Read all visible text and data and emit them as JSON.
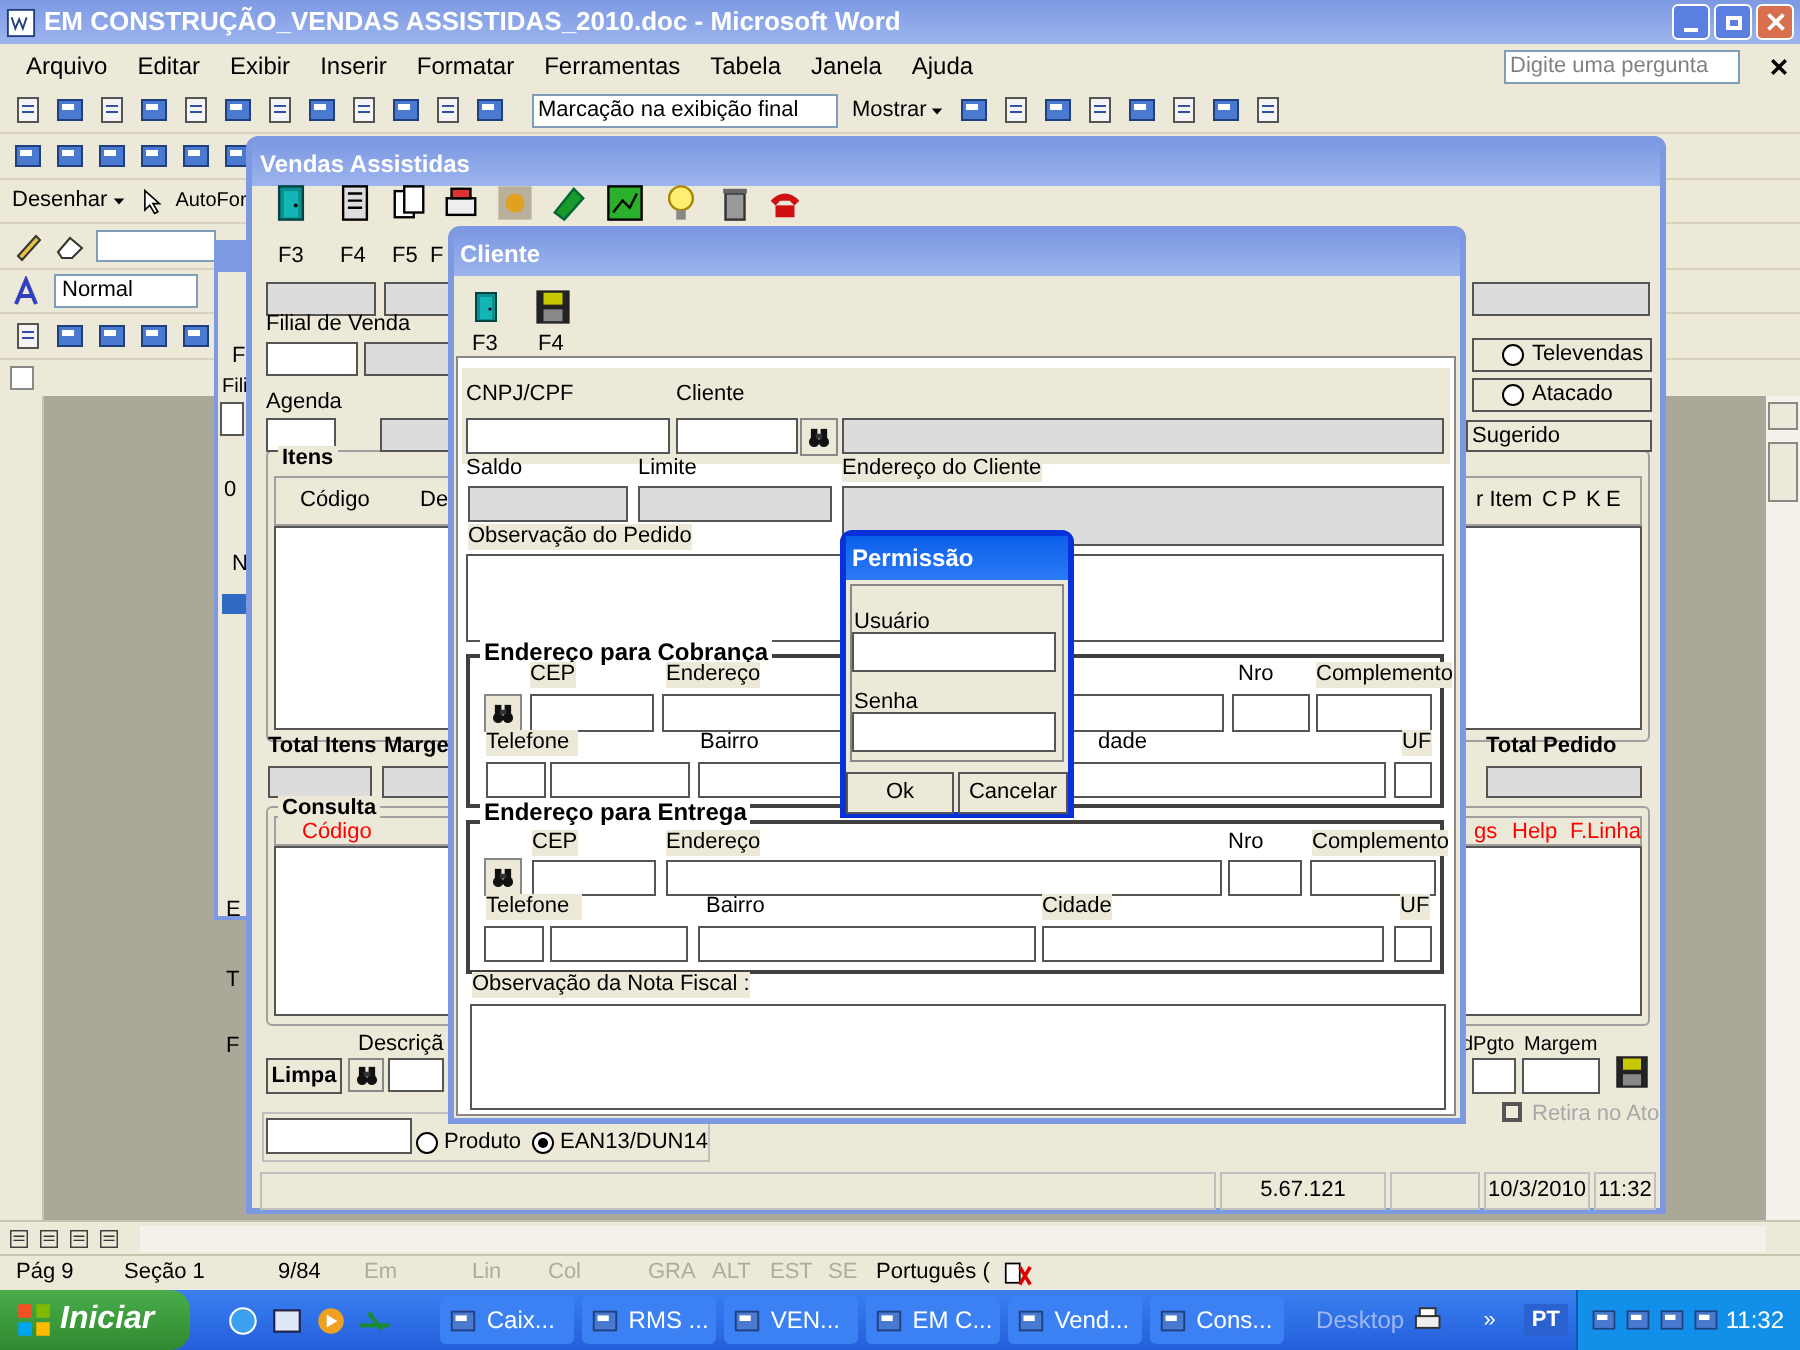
{
  "word": {
    "title": "EM CONSTRUÇÃO_VENDAS ASSISTIDAS_2010.doc - Microsoft Word",
    "menu": [
      "Arquivo",
      "Editar",
      "Exibir",
      "Inserir",
      "Formatar",
      "Ferramentas",
      "Tabela",
      "Janela",
      "Ajuda"
    ],
    "question_placeholder": "Digite uma pergunta",
    "markup_view": "Marcação na exibição final",
    "show_button": "Mostrar",
    "draw_menu": "Desenhar",
    "autoshapes_menu": "AutoFor",
    "style": "Normal",
    "status_bar": [
      {
        "text": "Pág 9",
        "disabled": false
      },
      {
        "text": "Seção 1",
        "disabled": false
      },
      {
        "text": "9/84",
        "disabled": false
      },
      {
        "text": "Em",
        "disabled": true
      },
      {
        "text": "Lin",
        "disabled": true
      },
      {
        "text": "Col",
        "disabled": true
      },
      {
        "text": "GRA",
        "disabled": true
      },
      {
        "text": "ALT",
        "disabled": true
      },
      {
        "text": "EST",
        "disabled": true
      },
      {
        "text": "SE",
        "disabled": true
      },
      {
        "text": "Português (",
        "disabled": false
      }
    ]
  },
  "background_window": {
    "labels": [
      "F",
      "Fili",
      "0",
      "N",
      "E",
      "T",
      "F"
    ]
  },
  "vendas": {
    "title": "Vendas Assistidas",
    "toolbar_keys": [
      "F3",
      "F4",
      "F5",
      "F"
    ],
    "labels": [
      "Filial de Venda",
      "Agenda",
      "Itens",
      "Código",
      "De",
      "r Item",
      "C",
      "P",
      "K",
      "E",
      "Total Itens",
      "Marge",
      "Total Pedido",
      "Consulta",
      "Código",
      "gs",
      "Help",
      "F.Linha",
      "Descriçã",
      "dPgto",
      "Margem"
    ],
    "modes": [
      {
        "label": "Televendas",
        "selected": false
      },
      {
        "label": "Atacado",
        "selected": false
      }
    ],
    "suggested": "Sugerido",
    "clear_button": "Limpa",
    "pickup": {
      "label": "Retira no Ato",
      "checked": false,
      "disabled": true
    },
    "search_by": [
      {
        "label": "Produto",
        "selected": false
      },
      {
        "label": "EAN13/DUN14",
        "selected": true
      }
    ],
    "status_bar": [
      "5.67.121",
      "10/3/2010",
      "11:32"
    ]
  },
  "cliente": {
    "title": "Cliente",
    "toolbar_keys": [
      "F3",
      "F4"
    ],
    "labels": [
      "CNPJ/CPF",
      "Cliente",
      "Saldo",
      "Limite",
      "Endereço do Cliente",
      "Observação do Pedido",
      "Endereço para Cobrança",
      "CEP",
      "Endereço",
      "Nro",
      "Complemento",
      "Telefone",
      "Bairro",
      "dade",
      "UF",
      "Endereço para Entrega",
      "CEP",
      "Endereço",
      "Nro",
      "Complemento",
      "Telefone",
      "Bairro",
      "Cidade",
      "UF",
      "Observação da Nota Fiscal :"
    ]
  },
  "permissao": {
    "title": "Permissão",
    "labels": [
      "Usuário",
      "Senha"
    ],
    "buttons": [
      "Ok",
      "Cancelar"
    ]
  },
  "taskbar": {
    "start": "Iniciar",
    "tasks": [
      {
        "label": "Caix...",
        "selected": false
      },
      {
        "label": "RMS ...",
        "selected": false
      },
      {
        "label": "VEN...",
        "selected": false
      },
      {
        "label": "EM C...",
        "selected": false
      },
      {
        "label": "Vend...",
        "selected": false
      },
      {
        "label": "Cons...",
        "selected": false
      }
    ],
    "desktop": "Desktop",
    "chevron": "»",
    "language": "PT",
    "clock": "11:32"
  }
}
